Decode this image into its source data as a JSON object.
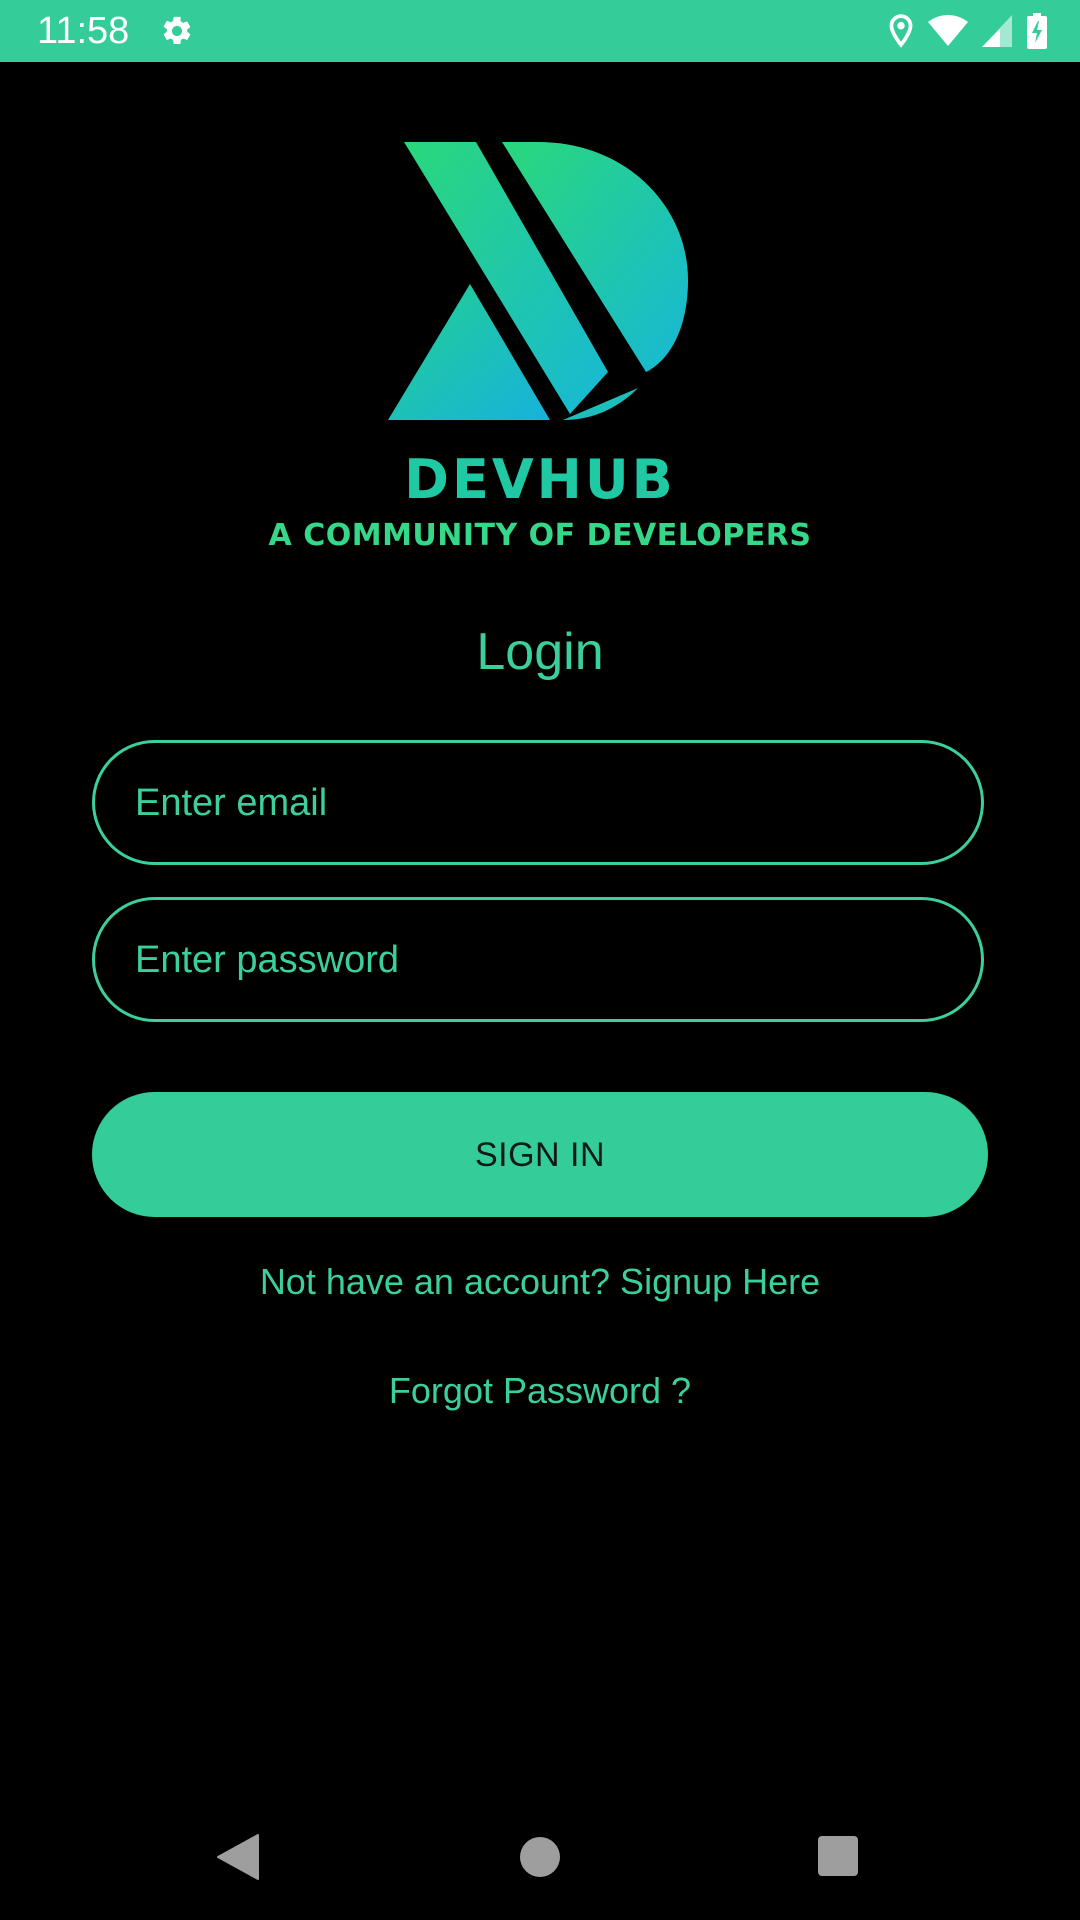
{
  "status_bar": {
    "time": "11:58",
    "icons": [
      "settings-gear-icon",
      "location-pin-icon",
      "wifi-icon",
      "cell-signal-icon",
      "battery-charging-icon"
    ],
    "background_color": "#34cc99"
  },
  "brand": {
    "logo_icon": "devhub-logo-icon",
    "name": "DEVHUB",
    "tagline": "A COMMUNITY OF DEVELOPERS"
  },
  "login": {
    "title": "Login",
    "email": {
      "placeholder": "Enter email",
      "value": ""
    },
    "password": {
      "placeholder": "Enter password",
      "value": ""
    },
    "sign_in_label": "SIGN IN",
    "signup_link": "Not have an account? Signup Here",
    "forgot_link": "Forgot Password ?"
  },
  "nav_bar": {
    "icons": [
      "back-icon",
      "home-icon",
      "recents-icon"
    ]
  },
  "colors": {
    "accent": "#3ccf9e",
    "background": "#000000"
  }
}
